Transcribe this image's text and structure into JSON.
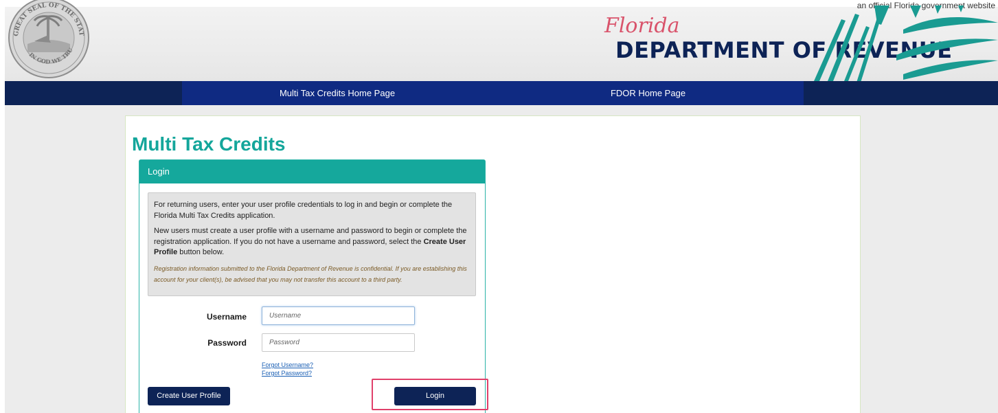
{
  "header": {
    "official_text": "an official Florida government website",
    "florida_script": "Florida",
    "dor_title": "DEPARTMENT OF REVENUE",
    "seal_top_text": "GREAT SEAL OF THE STATE OF FLORIDA",
    "seal_bottom_text": "IN GOD WE TRUST"
  },
  "nav": {
    "items": [
      {
        "label": "Multi Tax Credits Home Page"
      },
      {
        "label": "FDOR Home Page"
      }
    ]
  },
  "main": {
    "title": "Multi Tax Credits",
    "panel_title": "Login",
    "info": {
      "para1": "For returning users, enter your user profile credentials to log in and begin or complete the Florida Multi Tax Credits application.",
      "para2_pre": "New users must create a user profile with a username and password to begin or complete the registration application. If you do not have a username and password, select the ",
      "para2_bold": "Create User Profile",
      "para2_post": " button below.",
      "note": "Registration information submitted to the Florida Department of Revenue is confidential. If you are establishing this account for your client(s), be advised that you may not transfer this account to a third party."
    },
    "form": {
      "username_label": "Username",
      "username_placeholder": "Username",
      "username_value": "",
      "password_label": "Password",
      "password_placeholder": "Password",
      "password_value": "",
      "forgot_username": "Forgot Username?",
      "forgot_password": "Forgot Password?"
    },
    "buttons": {
      "create_profile": "Create User Profile",
      "login": "Login"
    }
  },
  "colors": {
    "navy": "#0d2356",
    "nav_blue": "#0f2a82",
    "teal": "#15a89c",
    "highlight": "#e0406a"
  }
}
